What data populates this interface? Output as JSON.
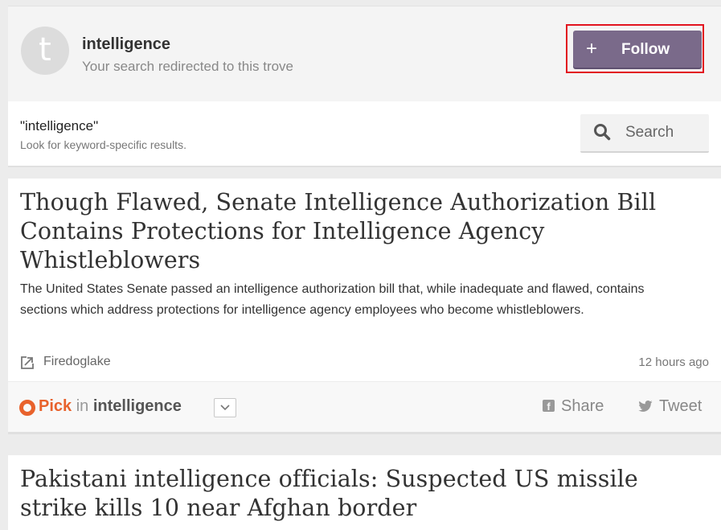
{
  "trove": {
    "avatar_letter": "t",
    "title": "intelligence",
    "subtitle": "Your search redirected to this trove",
    "follow_plus": "+",
    "follow_label": "Follow"
  },
  "keyword_search": {
    "query": "\"intelligence\"",
    "hint": "Look for keyword-specific results.",
    "button_label": "Search"
  },
  "articles": [
    {
      "title": "Though Flawed, Senate Intelligence Authorization Bill Contains Protections for Intelligence Agency Whistleblowers",
      "summary": "The United States Senate passed an intelligence authorization bill that, while inadequate and flawed, contains sections which address protections for intelligence agency employees who become whistleblowers.",
      "source": "Firedoglake",
      "time": "12 hours ago",
      "pick_label": "Pick",
      "pick_in": "in",
      "pick_trove": "intelligence",
      "share_label": "Share",
      "tweet_label": "Tweet"
    },
    {
      "title": "Pakistani intelligence officials: Suspected US missile strike kills 10 near Afghan border"
    }
  ],
  "colors": {
    "follow_button": "#7a6a8a",
    "highlight": "#e2131f",
    "pick_accent": "#e8622c"
  }
}
